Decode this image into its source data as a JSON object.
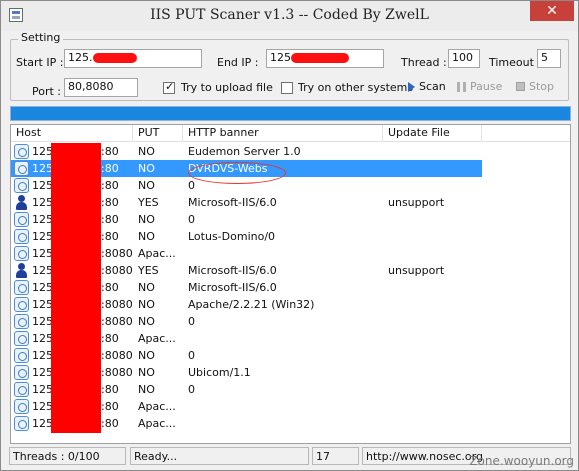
{
  "window": {
    "title": "IIS PUT Scaner v1.3 -- Coded By ZwelL",
    "close_label": "✕"
  },
  "settings": {
    "group_label": "Setting",
    "start_ip_label": "Start IP :",
    "start_ip_value": "125.",
    "end_ip_label": "End IP :",
    "end_ip_value": "125",
    "thread_label": "Thread :",
    "thread_value": "100",
    "timeout_label": "Timeout :",
    "timeout_value": "5",
    "port_label": "Port :",
    "port_value": "80,8080",
    "upload_label": "Try to upload file",
    "upload_checked": true,
    "other_systems_label": "Try on other systems",
    "other_systems_checked": false
  },
  "actions": {
    "scan": "Scan",
    "pause": "Pause",
    "stop": "Stop"
  },
  "progress": 1.0,
  "list": {
    "columns": [
      "Host",
      "PUT",
      "HTTP banner",
      "Update File"
    ],
    "rows": [
      {
        "icon": "host-icon",
        "host": "125",
        "port": ":80",
        "put": "NO",
        "banner": "Eudemon Server 1.0",
        "update": ""
      },
      {
        "icon": "host-icon",
        "host": "125",
        "port": ":80",
        "put": "NO",
        "banner": "DVRDVS-Webs",
        "update": "",
        "selected": true
      },
      {
        "icon": "host-icon",
        "host": "125",
        "port": ":80",
        "put": "NO",
        "banner": "0",
        "update": ""
      },
      {
        "icon": "user-icon",
        "host": "125",
        "port": ":80",
        "put": "YES",
        "banner": "Microsoft-IIS/6.0",
        "update": "unsupport"
      },
      {
        "icon": "host-icon",
        "host": "125",
        "port": ":80",
        "put": "NO",
        "banner": "0",
        "update": ""
      },
      {
        "icon": "host-icon",
        "host": "125",
        "port": ":80",
        "put": "NO",
        "banner": "Lotus-Domino/0",
        "update": ""
      },
      {
        "icon": "host-icon",
        "host": "125",
        "port": ":8080",
        "put": "Apac...",
        "banner": "",
        "update": ""
      },
      {
        "icon": "user-icon",
        "host": "125",
        "port": ":8080",
        "put": "YES",
        "banner": "Microsoft-IIS/6.0",
        "update": "unsupport"
      },
      {
        "icon": "host-icon",
        "host": "125",
        "port": ":80",
        "put": "NO",
        "banner": "Microsoft-IIS/6.0",
        "update": ""
      },
      {
        "icon": "host-icon",
        "host": "125",
        "port": ":8080",
        "put": "NO",
        "banner": "Apache/2.2.21 (Win32)",
        "update": ""
      },
      {
        "icon": "host-icon",
        "host": "125",
        "port": ":8080",
        "put": "NO",
        "banner": "0",
        "update": ""
      },
      {
        "icon": "host-icon",
        "host": "125",
        "port": ":80",
        "put": "Apac...",
        "banner": "",
        "update": ""
      },
      {
        "icon": "host-icon",
        "host": "125",
        "port": ":8080",
        "put": "NO",
        "banner": "0",
        "update": ""
      },
      {
        "icon": "host-icon",
        "host": "125",
        "port": ":8080",
        "put": "NO",
        "banner": "Ubicom/1.1",
        "update": ""
      },
      {
        "icon": "host-icon",
        "host": "125",
        "port": ":80",
        "put": "NO",
        "banner": "0",
        "update": ""
      },
      {
        "icon": "host-icon",
        "host": "125",
        "port": ":80",
        "put": "Apac...",
        "banner": "",
        "update": ""
      },
      {
        "icon": "host-icon",
        "host": "125",
        "port": ":80",
        "put": "Apac...",
        "banner": "",
        "update": ""
      }
    ]
  },
  "status": {
    "threads": "Threads : 0/100",
    "state": "Ready...",
    "count": "17",
    "url": "http://www.nosec.org"
  },
  "watermark": "Zone.wooyun.org",
  "colors": {
    "selection": "#3399ff",
    "progress": "#1a86e0",
    "redaction": "#ff0000",
    "annotation": "#e6342b"
  }
}
